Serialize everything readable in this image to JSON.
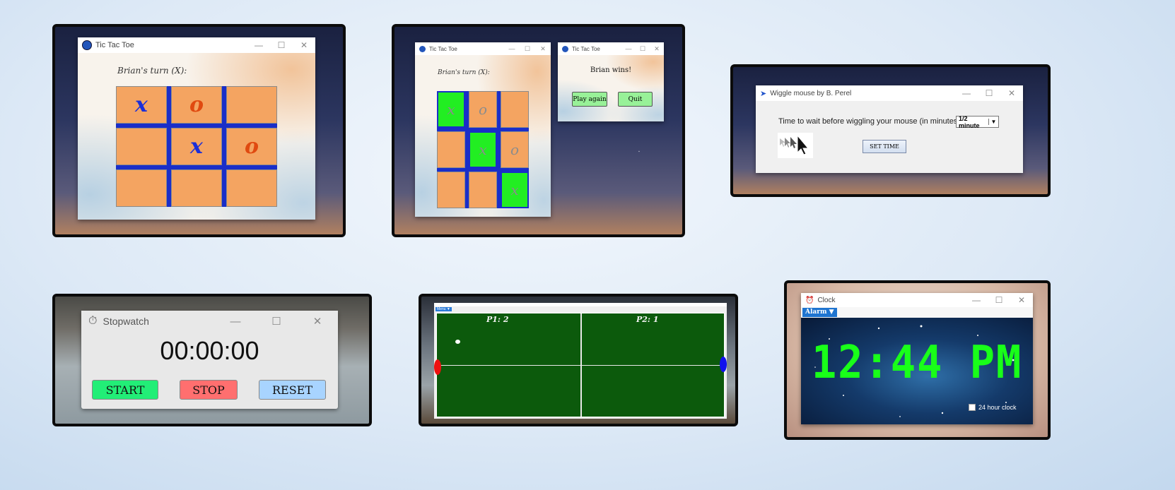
{
  "panel1": {
    "window": {
      "title": "Tic Tac Toe",
      "min": "—",
      "max": "☐",
      "close": "✕"
    },
    "turn_label": "Brian's turn (X):",
    "cells": [
      "x",
      "o",
      "",
      "",
      "x",
      "o",
      "",
      "",
      ""
    ]
  },
  "panel2": {
    "window": {
      "title": "Tic Tac Toe",
      "min": "—",
      "max": "☐",
      "close": "✕"
    },
    "turn_label": "Brian's turn (X):",
    "cells": [
      "x",
      "o",
      "",
      "",
      "x",
      "o",
      "",
      "",
      "x"
    ],
    "dialog": {
      "title": "Tic Tac Toe",
      "min": "—",
      "max": "☐",
      "close": "✕",
      "message": "Brian wins!",
      "play_again": "Play again",
      "quit": "Quit"
    }
  },
  "panel3": {
    "window": {
      "title": "Wiggle mouse by B. Perel",
      "min": "—",
      "max": "☐",
      "close": "✕"
    },
    "prompt": "Time to wait before wiggling your mouse (in minutes):",
    "select_value": "1/2 minute",
    "set_time": "SET TIME"
  },
  "panel4": {
    "window": {
      "title": "Stopwatch",
      "min": "—",
      "max": "☐",
      "close": "✕"
    },
    "time": "00:00:00",
    "start": "START",
    "stop": "STOP",
    "reset": "RESET",
    "colors": {
      "start": "#22ee77",
      "stop": "#ff6f6f",
      "reset": "#a8d4ff"
    }
  },
  "panel5": {
    "menu": "Menu ▼",
    "p1_score": "P1: 2",
    "p2_score": "P2: 1",
    "colors": {
      "court": "#0c5a0c",
      "left_paddle": "#ee1111",
      "right_paddle": "#1111ee"
    }
  },
  "panel6": {
    "window": {
      "title": "Clock",
      "min": "—",
      "max": "☐",
      "close": "✕"
    },
    "alarm": "Alarm ▼",
    "time": "12:44 PM",
    "checkbox_label": "24 hour clock",
    "colors": {
      "digits": "#19ff19"
    }
  }
}
